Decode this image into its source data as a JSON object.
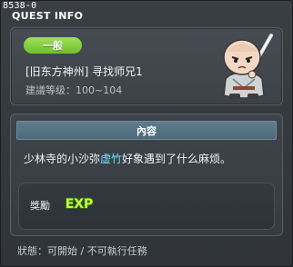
{
  "window": {
    "id_label": "8538-0",
    "title": "QUEST INFO"
  },
  "quest": {
    "category_badge": "一般",
    "name": "[旧东方神州] 寻找师兄1",
    "level_requirement": "建議等级：100~104"
  },
  "content": {
    "header": "內容",
    "description_prefix": "少林寺的小沙弥",
    "description_highlight": "虚竹",
    "description_suffix": "好象遇到了什么麻烦。"
  },
  "reward": {
    "label": "獎勵",
    "exp_icon_text": "EXP"
  },
  "status": {
    "text": "狀態：可開始 / 不可執行任務"
  },
  "colors": {
    "badge": "#8fd548",
    "highlight": "#6fe1ff",
    "exp_text": "#c8ff3a",
    "header": "#5a7786"
  },
  "icons": {
    "portrait": "shaolin-monk-npc-portrait",
    "exp": "exp-reward-icon"
  }
}
